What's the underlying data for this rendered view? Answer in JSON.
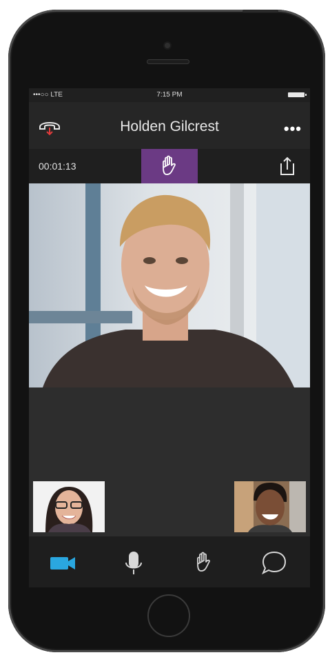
{
  "status_bar": {
    "carrier": "•••○○ LTE",
    "time": "7:15 PM"
  },
  "call": {
    "contact_name": "Holden Gilcrest",
    "more_label": "•••",
    "duration": "00:01:13"
  },
  "colors": {
    "accent": "#6b3a84",
    "active_tab": "#2aa7e0",
    "hangup": "#e23b3b"
  },
  "icons": {
    "hangup": "phone-hangup-icon",
    "more": "more-icon",
    "raise_hand": "raise-hand-icon",
    "share": "share-icon",
    "tabs": [
      "video-camera-icon",
      "microphone-icon",
      "hand-icon",
      "chat-icon"
    ]
  }
}
